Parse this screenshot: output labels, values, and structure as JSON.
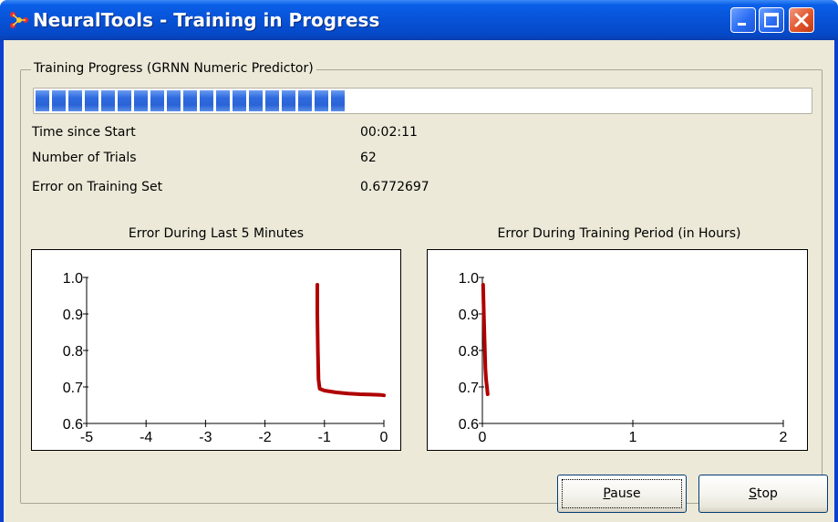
{
  "window": {
    "title": "NeuralTools - Training in Progress",
    "icon": "neuraltools-app-icon"
  },
  "group": {
    "label": "Training Progress (GRNN Numeric Predictor)"
  },
  "progress": {
    "fraction": 0.4
  },
  "stats": [
    {
      "label": "Time since Start",
      "value": "00:02:11"
    },
    {
      "label": "Number of Trials",
      "value": "62"
    },
    {
      "label": "Error on Training Set",
      "value": "0.6772697"
    }
  ],
  "chart_data": [
    {
      "type": "line",
      "title": "Error During Last 5 Minutes",
      "xlabel": "",
      "ylabel": "",
      "xlim": [
        -5,
        0
      ],
      "ylim": [
        0.6,
        1.0
      ],
      "xticks": [
        "-5",
        "-4",
        "-3",
        "-2",
        "-1",
        "0"
      ],
      "yticks": [
        "0.6",
        "0.7",
        "0.8",
        "0.9",
        "1.0"
      ],
      "grid": false,
      "series": [
        {
          "x": [
            -1.12,
            -1.12,
            -1.11,
            -1.1,
            -1.08,
            -1.0,
            -0.8,
            -0.6,
            -0.4,
            -0.2,
            -0.05,
            0.0
          ],
          "y": [
            0.98,
            0.9,
            0.8,
            0.72,
            0.695,
            0.69,
            0.685,
            0.682,
            0.68,
            0.679,
            0.678,
            0.677
          ]
        }
      ]
    },
    {
      "type": "line",
      "title": "Error During Training Period (in Hours)",
      "xlabel": "",
      "ylabel": "",
      "xlim": [
        0,
        2
      ],
      "ylim": [
        0.6,
        1.0
      ],
      "xticks": [
        "0",
        "1",
        "2"
      ],
      "yticks": [
        "0.6",
        "0.7",
        "0.8",
        "0.9",
        "1.0"
      ],
      "grid": false,
      "series": [
        {
          "x": [
            0.005,
            0.01,
            0.015,
            0.02,
            0.025,
            0.03,
            0.035
          ],
          "y": [
            0.98,
            0.9,
            0.82,
            0.75,
            0.72,
            0.7,
            0.68
          ]
        }
      ]
    }
  ],
  "buttons": {
    "pause": {
      "mnemonic": "P",
      "rest": "ause"
    },
    "stop": {
      "mnemonic": "S",
      "rest": "top"
    }
  },
  "colors": {
    "line": "#b00000",
    "progress": "#2f6ce0"
  }
}
